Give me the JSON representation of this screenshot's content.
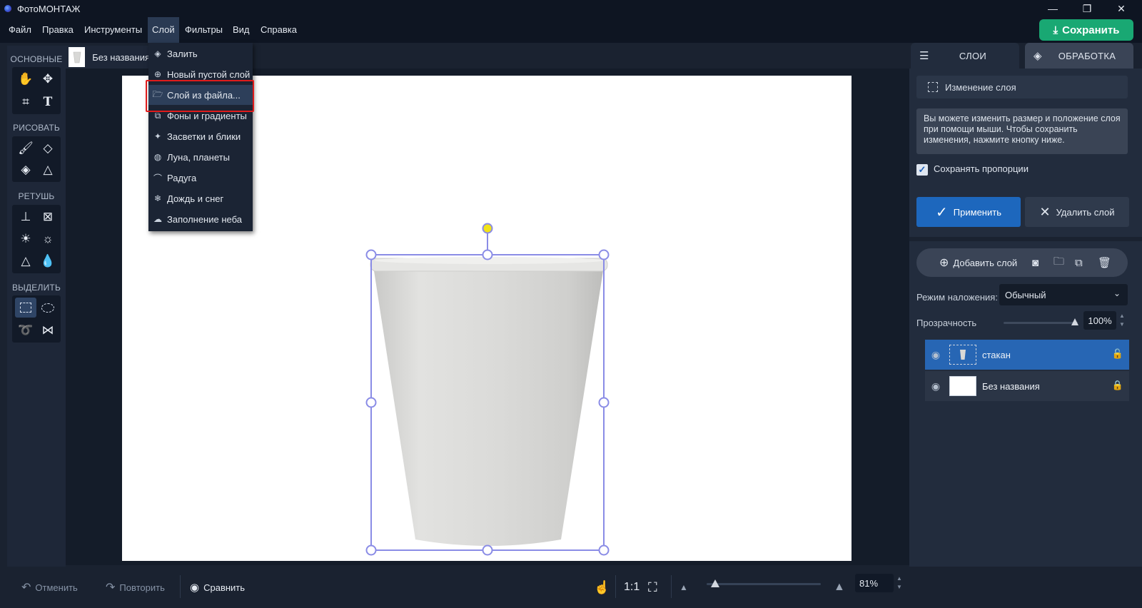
{
  "window": {
    "title": "ФотоМОНТАЖ",
    "minimize": "—",
    "restore": "❐",
    "close": "✕"
  },
  "menu": [
    "Файл",
    "Правка",
    "Инструменты",
    "Слой",
    "Фильтры",
    "Вид",
    "Справка"
  ],
  "save_button": "Сохранить",
  "toolbox": {
    "sections": [
      "ОСНОВНЫЕ",
      "РИСОВАТЬ",
      "РЕТУШЬ",
      "ВЫДЕЛИТЬ"
    ]
  },
  "document_tab": {
    "name": "Без названия"
  },
  "layer_menu": {
    "items": [
      {
        "label": "Залить",
        "icon": "fill-bucket-icon"
      },
      {
        "label": "Новый пустой слой",
        "icon": "plus-circle-icon"
      },
      {
        "label": "Слой из файла...",
        "icon": "folder-icon",
        "highlighted": true
      },
      {
        "label": "Фоны и градиенты",
        "icon": "layers-icon"
      },
      {
        "label": "Засветки и блики",
        "icon": "sparkle-icon"
      },
      {
        "label": "Луна, планеты",
        "icon": "planet-icon"
      },
      {
        "label": "Радуга",
        "icon": "rainbow-icon"
      },
      {
        "label": "Дождь и снег",
        "icon": "snowflake-icon"
      },
      {
        "label": "Заполнение неба",
        "icon": "cloud-icon"
      }
    ]
  },
  "bottom_bar": {
    "undo": "Отменить",
    "redo": "Повторить",
    "compare": "Сравнить",
    "ratio": "1:1",
    "zoom_value": "81%"
  },
  "right_panel": {
    "tabs": [
      "СЛОИ",
      "ОБРАБОТКА"
    ],
    "change_layer": "Изменение слоя",
    "info": "Вы можете изменить размер и положение слоя при помощи мыши. Чтобы сохранить изменения, нажмите кнопку ниже.",
    "keep_proportions": "Сохранять пропорции",
    "apply": "Применить",
    "delete_layer": "Удалить слой",
    "add_layer": "Добавить слой",
    "blend_label": "Режим наложения:",
    "blend_value": "Обычный",
    "opacity_label": "Прозрачность",
    "opacity_value": "100%",
    "layers": [
      {
        "name": "стакан",
        "selected": true
      },
      {
        "name": "Без названия",
        "selected": false
      }
    ]
  },
  "colors": {
    "accent": "#1d67bd",
    "save": "#19a873",
    "highlight": "#e01b1b",
    "handle": "#8a8ce6"
  }
}
